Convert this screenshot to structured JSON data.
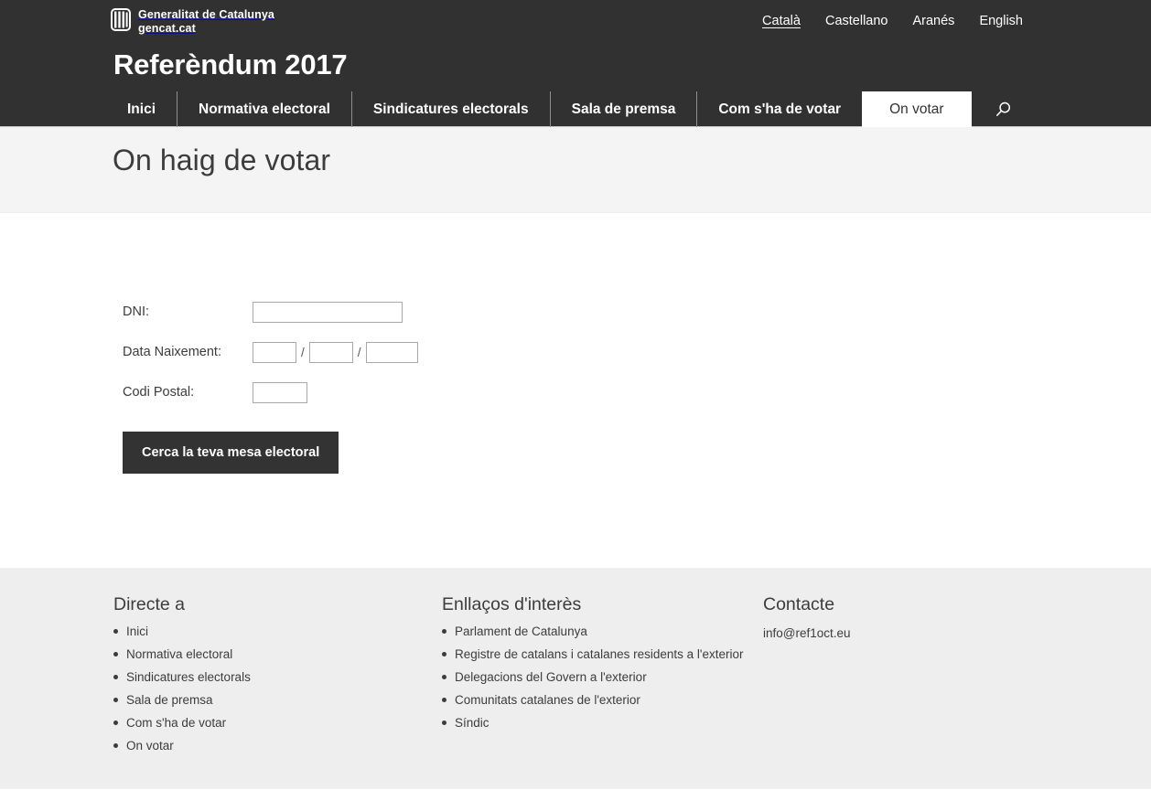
{
  "header": {
    "brand": {
      "line1": "Generalitat de Catalunya",
      "line2": "gencat.cat",
      "logo_icon": "generalitat-shield-icon"
    },
    "site_title": "Referèndum 2017",
    "languages": [
      {
        "label": "Català",
        "active": true
      },
      {
        "label": "Castellano",
        "active": false
      },
      {
        "label": "Aranés",
        "active": false
      },
      {
        "label": "English",
        "active": false
      }
    ],
    "nav": [
      {
        "label": "Inici",
        "active": false
      },
      {
        "label": "Normativa electoral",
        "active": false
      },
      {
        "label": "Sindicatures electorals",
        "active": false
      },
      {
        "label": "Sala de premsa",
        "active": false
      },
      {
        "label": "Com s'ha de votar",
        "active": false
      },
      {
        "label": "On votar",
        "active": true
      }
    ],
    "search_icon": "search-icon"
  },
  "page": {
    "title": "On haig de votar"
  },
  "form": {
    "dni": {
      "label": "DNI:",
      "value": "",
      "placeholder": ""
    },
    "birthdate": {
      "label": "Data Naixement:",
      "day": {
        "value": "",
        "placeholder": ""
      },
      "month": {
        "value": "",
        "placeholder": ""
      },
      "year": {
        "value": "",
        "placeholder": ""
      },
      "separator": "/"
    },
    "postcode": {
      "label": "Codi Postal:",
      "value": "",
      "placeholder": ""
    },
    "submit_label": "Cerca la teva mesa electoral"
  },
  "footer": {
    "col_direct": {
      "heading": "Directe a",
      "items": [
        "Inici",
        "Normativa electoral",
        "Sindicatures electorals",
        "Sala de premsa",
        "Com s'ha de votar",
        "On votar"
      ]
    },
    "col_links": {
      "heading": "Enllaços d'interès",
      "items": [
        "Parlament de Catalunya",
        "Registre de catalans i catalanes residents a l'exterior",
        "Delegacions del Govern a l'exterior",
        "Comunitats catalanes de l'exterior",
        "Síndic"
      ]
    },
    "col_contact": {
      "heading": "Contacte",
      "email": "info@ref1oct.eu"
    }
  },
  "colors": {
    "header_bg": "#313131",
    "title_band_bg": "#f4f4f4",
    "footer_bg": "#eeeeee",
    "button_bg": "#333333",
    "text": "#3c3c3c"
  }
}
